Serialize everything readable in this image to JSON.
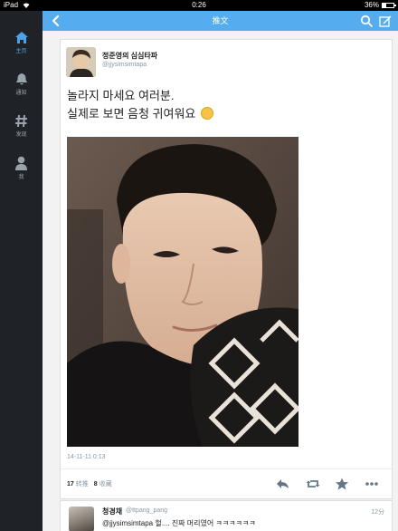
{
  "status_bar": {
    "device": "iPad",
    "time": "0:26",
    "battery": "36%",
    "battery_level": 0.36
  },
  "sidebar": {
    "items": [
      {
        "label": "主页",
        "icon": "home-icon",
        "active": true
      },
      {
        "label": "通知",
        "icon": "bell-icon",
        "active": false
      },
      {
        "label": "发现",
        "icon": "hashtag-icon",
        "active": false
      },
      {
        "label": "我",
        "icon": "person-icon",
        "active": false
      }
    ]
  },
  "navbar": {
    "title": "推文"
  },
  "tweet": {
    "author_name": "정준영의 심심타파",
    "author_handle": "@jjysimsimtapa",
    "text_line1": "놀라지 마세요 여러분.",
    "text_line2": "실제로 보면 음청 귀여워요",
    "timestamp": "14-11-11 0:13",
    "retweets_count": "17",
    "retweets_label": "转推",
    "favorites_count": "8",
    "favorites_label": "收藏"
  },
  "reply": {
    "author_name": "청경채",
    "author_handle": "@ttpang_pang",
    "time": "12分",
    "text": "@jjysimsimtapa 헐.... 진짜 머리였어 ㅋㅋㅋㅋㅋㅋ"
  },
  "colors": {
    "accent": "#55acee",
    "sidebar_bg": "#1f2327",
    "active_icon": "#4ea3e8"
  }
}
